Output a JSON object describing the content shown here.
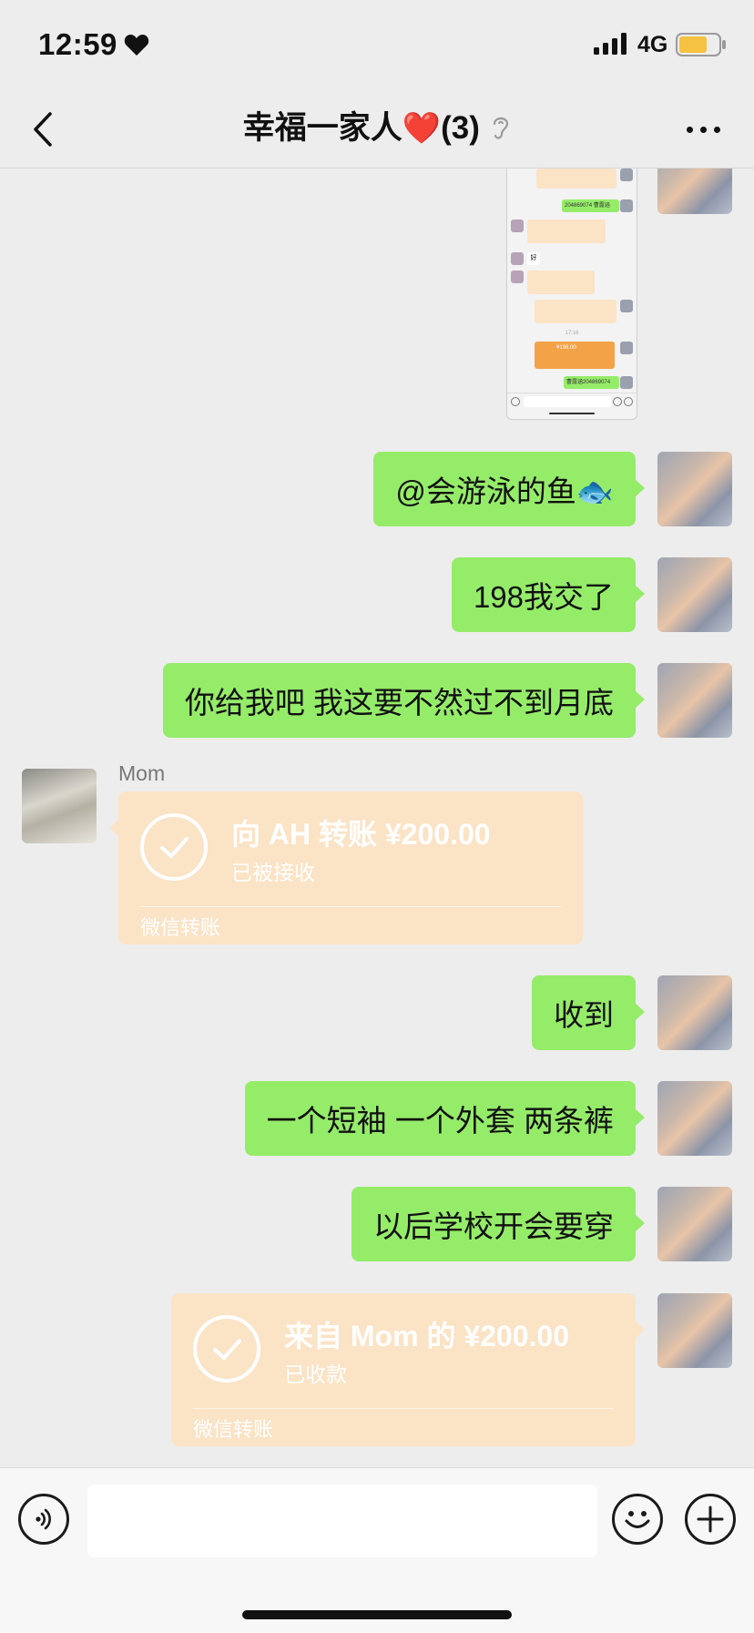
{
  "status_bar": {
    "time": "12:59",
    "network": "4G",
    "battery_color": "#f5c242"
  },
  "nav": {
    "title": "幸福一家人",
    "title_heart": "❤️",
    "member_count": "(3)",
    "muted_icon": "ear-icon"
  },
  "messages": [
    {
      "type": "image",
      "from": "me"
    },
    {
      "type": "text",
      "from": "me",
      "text": "@会游泳的鱼🐟"
    },
    {
      "type": "text",
      "from": "me",
      "text": "198我交了"
    },
    {
      "type": "text",
      "from": "me",
      "text": "你给我吧 我这要不然过不到月底"
    },
    {
      "type": "transfer",
      "from": "Mom",
      "sender_name": "Mom",
      "amount_text": "向 AH 转账 ¥200.00",
      "status": "已被接收",
      "footer": "微信转账"
    },
    {
      "type": "text",
      "from": "me",
      "text": "收到"
    },
    {
      "type": "text",
      "from": "me",
      "text": "一个短袖 一个外套 两条裤"
    },
    {
      "type": "text",
      "from": "me",
      "text": "以后学校开会要穿"
    },
    {
      "type": "transfer",
      "from": "me",
      "amount_text": "来自 Mom 的 ¥200.00",
      "status": "已收款",
      "footer": "微信转账"
    }
  ],
  "thumbnail": {
    "rows": [
      {
        "side": "right",
        "kind": "transfer"
      },
      {
        "side": "right",
        "kind": "text",
        "text": "204869074 曹露涵"
      },
      {
        "side": "left",
        "kind": "transfer"
      },
      {
        "side": "left",
        "kind": "text",
        "text": "好"
      },
      {
        "side": "left",
        "kind": "transfer"
      },
      {
        "side": "right",
        "kind": "transfer"
      },
      {
        "side": "center",
        "kind": "time",
        "text": "17:16"
      },
      {
        "side": "right",
        "kind": "transfer-active",
        "text": "¥198.00"
      },
      {
        "side": "right",
        "kind": "text",
        "text": "曹露涵204869074"
      }
    ]
  },
  "input_bar": {
    "placeholder": "",
    "voice_icon": "voice-icon",
    "emoji_icon": "emoji-icon",
    "add_icon": "plus-icon"
  },
  "colors": {
    "bubble_me": "#95ec69",
    "transfer_card": "#fbe3c6",
    "background": "#ededed"
  }
}
